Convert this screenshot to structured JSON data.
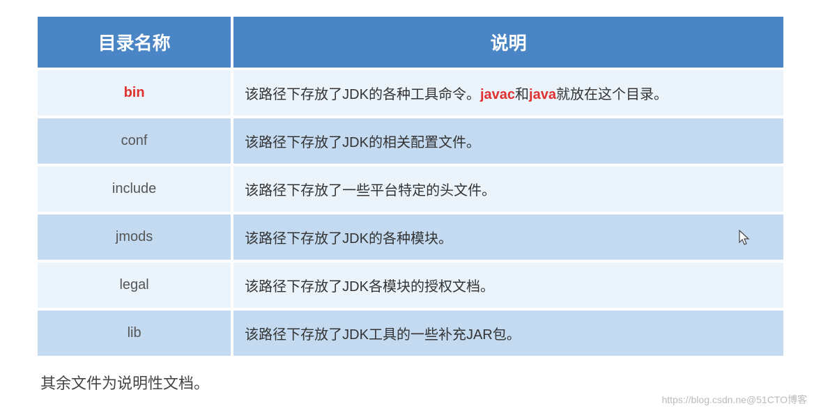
{
  "headers": {
    "name": "目录名称",
    "desc": "说明"
  },
  "rows": [
    {
      "name": "bin",
      "nameHighlight": true,
      "desc_prefix": "该路径下存放了JDK的各种工具命令。",
      "desc_highlight1": "javac",
      "desc_mid": "和",
      "desc_highlight2": "java",
      "desc_suffix": "就放在这个目录。"
    },
    {
      "name": "conf",
      "desc": "该路径下存放了JDK的相关配置文件。"
    },
    {
      "name": "include",
      "desc": "该路径下存放了一些平台特定的头文件。"
    },
    {
      "name": "jmods",
      "desc": "该路径下存放了JDK的各种模块。"
    },
    {
      "name": "legal",
      "desc": "该路径下存放了JDK各模块的授权文档。"
    },
    {
      "name": "lib",
      "desc": "该路径下存放了JDK工具的一些补充JAR包。"
    }
  ],
  "footnote": "其余文件为说明性文档。",
  "watermark": "https://blog.csdn.ne@51CTO博客"
}
